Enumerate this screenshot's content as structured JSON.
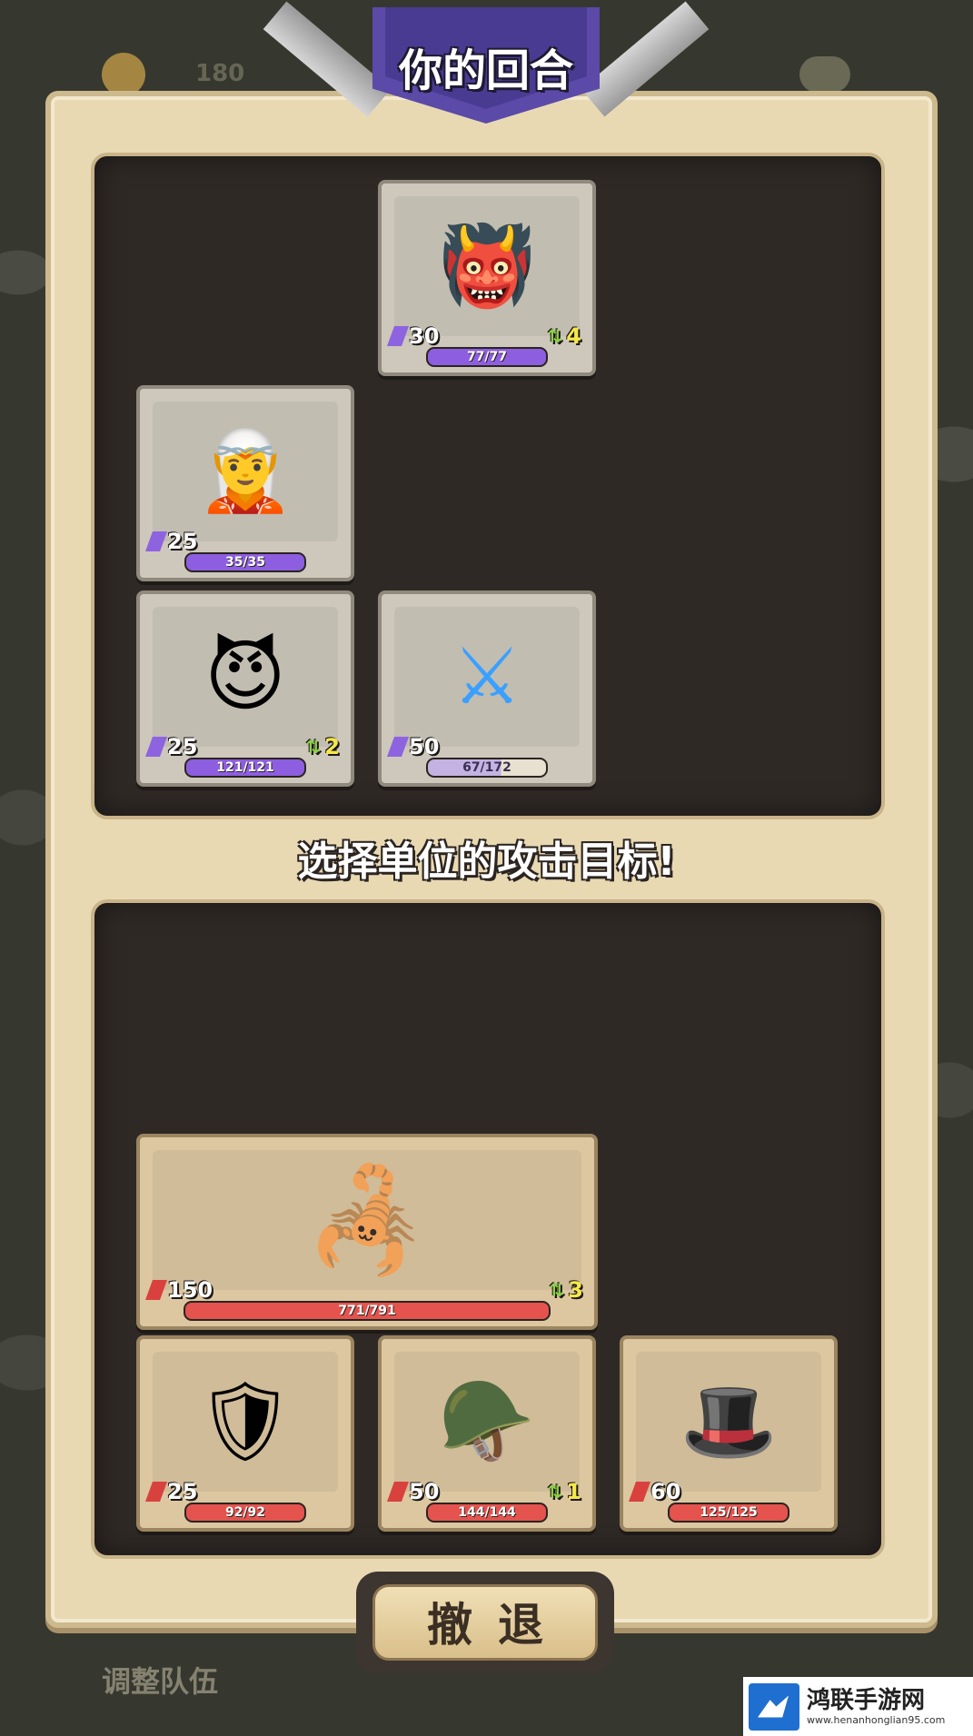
{
  "header": {
    "title": "你的回合",
    "resource_count": "180"
  },
  "instruction": "选择单位的攻击目标!",
  "enemy_units": [
    {
      "id": "hooded-demon",
      "icon": "hooded-demon",
      "glyph": "👹",
      "attack": "30",
      "speed": "4",
      "hp": "77/77"
    },
    {
      "id": "green-hat-ranger",
      "icon": "green-hat-ranger",
      "glyph": "🧝",
      "attack": "25",
      "speed": "",
      "hp": "35/35"
    },
    {
      "id": "purple-imp",
      "icon": "purple-imp",
      "glyph": "😈",
      "attack": "25",
      "speed": "2",
      "hp": "121/121"
    },
    {
      "id": "dark-knight",
      "icon": "dark-knight",
      "glyph": "⚔",
      "attack": "50",
      "speed": "",
      "hp": "67/172"
    }
  ],
  "ally_units": [
    {
      "id": "manticore",
      "icon": "manticore",
      "glyph": "🦂",
      "attack": "150",
      "speed": "3",
      "hp": "771/791"
    },
    {
      "id": "black-knight",
      "icon": "black-knight",
      "glyph": "🛡",
      "attack": "25",
      "speed": "",
      "hp": "92/92"
    },
    {
      "id": "plumed-knight",
      "icon": "plumed-knight",
      "glyph": "🪖",
      "attack": "50",
      "speed": "1",
      "hp": "144/144"
    },
    {
      "id": "purple-hat-archer",
      "icon": "purple-hat-archer",
      "glyph": "🎩",
      "attack": "60",
      "speed": "",
      "hp": "125/125"
    }
  ],
  "footer": {
    "retreat_label": "撤退",
    "adjust_team_label": "调整队伍"
  },
  "watermark": {
    "title": "鸿联手游网",
    "url": "www.henanhonglian95.com"
  }
}
